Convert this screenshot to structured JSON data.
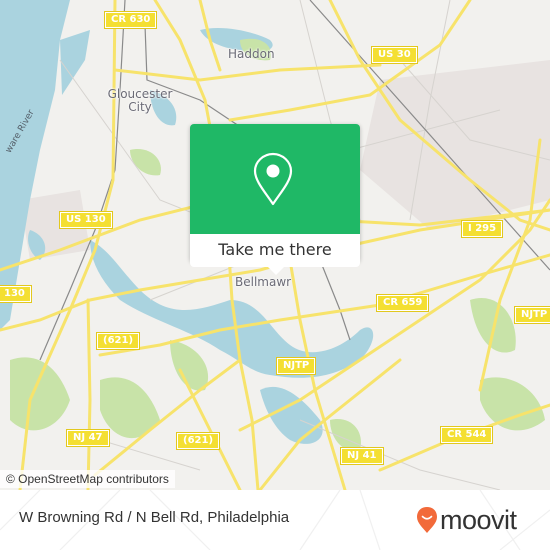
{
  "map": {
    "place_labels": [
      {
        "name": "Haddon"
      },
      {
        "name": "Gloucester City"
      },
      {
        "name": "Bellmawr"
      }
    ],
    "water_labels": [
      {
        "name": "Delaware River",
        "visible_text": "ware River"
      }
    ],
    "road_shields": [
      {
        "label": "CR 630"
      },
      {
        "label": "US 30"
      },
      {
        "label": "US 130"
      },
      {
        "label": "I 295"
      },
      {
        "label": "130"
      },
      {
        "label": "CR 659"
      },
      {
        "label": "NJTP"
      },
      {
        "label": "(621)"
      },
      {
        "label": "NJTP"
      },
      {
        "label": "NJ 47"
      },
      {
        "label": "(621)"
      },
      {
        "label": "CR 544"
      },
      {
        "label": "NJ 41"
      }
    ],
    "attribution": "© OpenStreetMap contributors",
    "colors": {
      "land": "#f2f1ee",
      "water": "#aad3df",
      "park": "#c8e3a8",
      "road": "#f7e36b",
      "residential": "#e8e3e1"
    }
  },
  "popup": {
    "icon": "map-pin-icon",
    "button_label": "Take me there",
    "accent_color": "#1fb866"
  },
  "footer": {
    "title": "W Browning Rd / N Bell Rd, Philadelphia",
    "brand": "moovit",
    "brand_color": "#f26a3a"
  }
}
